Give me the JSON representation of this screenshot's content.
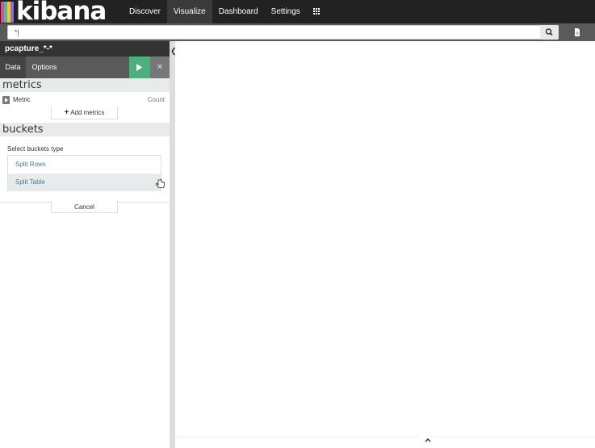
{
  "app": {
    "logo_text": "kibana"
  },
  "nav": {
    "items": [
      {
        "label": "Discover",
        "active": false
      },
      {
        "label": "Visualize",
        "active": true
      },
      {
        "label": "Dashboard",
        "active": false
      },
      {
        "label": "Settings",
        "active": false
      }
    ]
  },
  "search": {
    "value": "*|"
  },
  "sidebar": {
    "index_pattern": "pcapture_*-*",
    "tabs": {
      "data": "Data",
      "options": "Options"
    },
    "metrics": {
      "heading": "metrics",
      "row_label": "Metric",
      "row_value": "Count",
      "add_button": "Add metrics"
    },
    "buckets": {
      "heading": "buckets",
      "select_label": "Select buckets type",
      "options": [
        "Split Rows",
        "Split Table"
      ],
      "cancel": "Cancel"
    }
  },
  "colors": {
    "nav_bg": "#222222",
    "run_button": "#4caf7d",
    "logo_bars": [
      "#e8488b",
      "#3cbeb1",
      "#fec514",
      "#8b6ee0"
    ]
  }
}
